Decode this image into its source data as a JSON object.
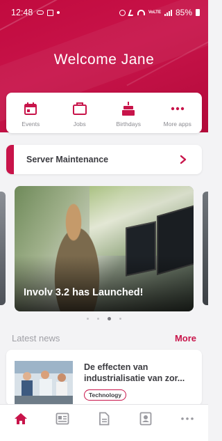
{
  "status_bar": {
    "time": "12:48",
    "battery": "85%",
    "volte_label": "VoLTE"
  },
  "header": {
    "welcome": "Welcome Jane"
  },
  "apps": [
    {
      "label": "Events",
      "icon": "calendar-icon"
    },
    {
      "label": "Jobs",
      "icon": "briefcase-icon"
    },
    {
      "label": "Birthdays",
      "icon": "cake-icon"
    },
    {
      "label": "More apps",
      "icon": "more-dots-icon"
    }
  ],
  "notice": {
    "title": "Server Maintenance"
  },
  "carousel": {
    "slide_title": "Involv 3.2 has Launched!",
    "slide_count": 4,
    "active_index": 2
  },
  "news": {
    "section_title": "Latest news",
    "more_label": "More",
    "items": [
      {
        "headline_line1": "De effecten van",
        "headline_line2": "industrialisatie van zor...",
        "tag": "Technology"
      }
    ]
  },
  "bottom_nav": [
    {
      "name": "home",
      "icon": "home-icon",
      "active": true
    },
    {
      "name": "news",
      "icon": "newspaper-icon",
      "active": false
    },
    {
      "name": "documents",
      "icon": "document-icon",
      "active": false
    },
    {
      "name": "profile",
      "icon": "profile-card-icon",
      "active": false
    },
    {
      "name": "more",
      "icon": "more-horizontal-icon",
      "active": false
    }
  ],
  "colors": {
    "brand": "#c8144a",
    "text": "#3b3b40",
    "muted": "#8a8a90",
    "background": "#f3f3f5"
  }
}
